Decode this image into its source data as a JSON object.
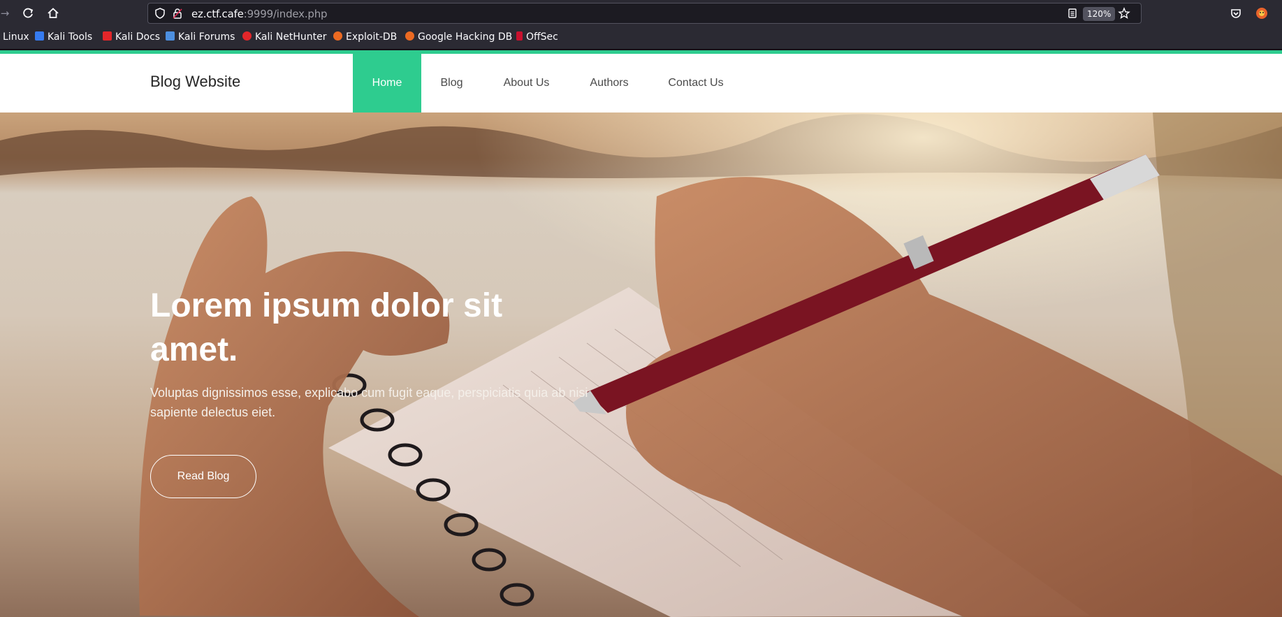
{
  "browser": {
    "url_host": "ez.ctf.cafe",
    "url_rest": ":9999/index.php",
    "zoom": "120%",
    "icons": {
      "forward": "arrow-right-icon",
      "reload": "reload-icon",
      "home": "home-icon",
      "shield": "shield-icon",
      "lock": "lock-icon",
      "reader": "reader-mode-icon",
      "star": "bookmark-star-icon",
      "pocket": "pocket-icon",
      "extension": "extension-icon"
    }
  },
  "bookmarks": [
    {
      "label": "Linux",
      "color": ""
    },
    {
      "label": "Kali Tools",
      "color": "#367bf0"
    },
    {
      "label": "Kali Docs",
      "color": "#e3262a"
    },
    {
      "label": "Kali Forums",
      "color": "#4d8fe0"
    },
    {
      "label": "Kali NetHunter",
      "color": "#e3262a"
    },
    {
      "label": "Exploit-DB",
      "color": "#ec6a22"
    },
    {
      "label": "Google Hacking DB",
      "color": "#ec6a22"
    },
    {
      "label": "OffSec",
      "color": "#c8102e"
    }
  ],
  "site": {
    "brand": "Blog Website",
    "accent_color": "#2ecc8f",
    "nav": [
      {
        "label": "Home",
        "active": true
      },
      {
        "label": "Blog",
        "active": false
      },
      {
        "label": "About Us",
        "active": false
      },
      {
        "label": "Authors",
        "active": false
      },
      {
        "label": "Contact Us",
        "active": false
      }
    ]
  },
  "hero": {
    "title": "Lorem ipsum dolor sit amet.",
    "subtitle": "Voluptas dignissimos esse, explicabo cum fugit eaque, perspiciatis quia ab nisi sapiente delectus eiet.",
    "button": "Read Blog"
  }
}
